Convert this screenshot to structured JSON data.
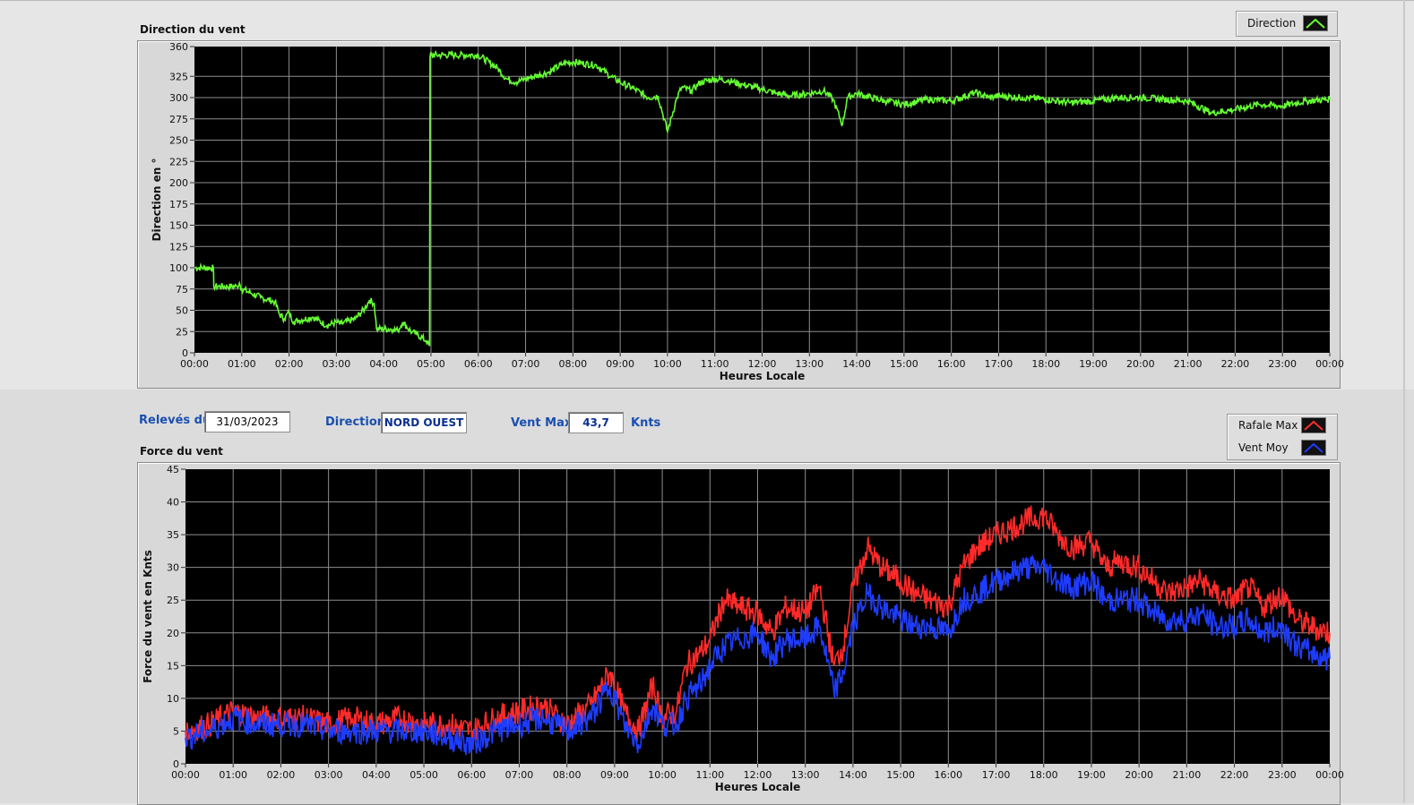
{
  "direction_panel": {
    "title": "Direction du vent",
    "legend": [
      {
        "label": "Direction",
        "color": "#66ff33"
      }
    ]
  },
  "info_bar": {
    "date_label": "Relevés du",
    "date_value": "31/03/2023",
    "direction_label": "Direction",
    "direction_value": "NORD OUEST",
    "ventmax_label": "Vent Max",
    "ventmax_value": "43,7",
    "ventmax_unit": "Knts"
  },
  "force_panel": {
    "title": "Force du vent",
    "legend": [
      {
        "label": "Rafale Max",
        "color": "#ff2a2a"
      },
      {
        "label": "Vent Moy",
        "color": "#1e3cff"
      }
    ]
  },
  "chart_data": [
    {
      "type": "line",
      "title": "Direction du vent",
      "xlabel": "Heures Locale",
      "ylabel": "Direction en °",
      "ylim": [
        0,
        360
      ],
      "xlim": [
        0,
        24
      ],
      "grid": true,
      "legend_position": "top-right",
      "x_ticks": [
        "00:00",
        "01:00",
        "02:00",
        "03:00",
        "04:00",
        "05:00",
        "06:00",
        "07:00",
        "08:00",
        "09:00",
        "10:00",
        "11:00",
        "12:00",
        "13:00",
        "14:00",
        "15:00",
        "16:00",
        "17:00",
        "18:00",
        "19:00",
        "20:00",
        "21:00",
        "22:00",
        "23:00",
        "00:00"
      ],
      "y_ticks": [
        "0",
        "25",
        "50",
        "75",
        "100",
        "125",
        "150",
        "175",
        "200",
        "225",
        "250",
        "275",
        "300",
        "325",
        "360"
      ],
      "series": [
        {
          "name": "Direction",
          "color": "#66ff33",
          "x": [
            0,
            0.4,
            0.41,
            0.9,
            0.95,
            1.0,
            1.2,
            1.4,
            1.7,
            1.8,
            1.9,
            2.0,
            2.1,
            2.2,
            2.5,
            2.8,
            3.0,
            3.1,
            3.4,
            3.6,
            3.7,
            3.8,
            3.85,
            4.2,
            4.3,
            4.4,
            4.6,
            4.7,
            4.9,
            4.97,
            4.98,
            5.0,
            5.5,
            6.0,
            6.4,
            6.6,
            6.8,
            7.0,
            7.5,
            7.8,
            8.0,
            8.5,
            8.8,
            9.0,
            9.3,
            9.6,
            9.8,
            10.0,
            10.2,
            10.3,
            10.5,
            10.7,
            11.0,
            11.3,
            11.6,
            12.0,
            12.3,
            12.6,
            13.0,
            13.3,
            13.5,
            13.7,
            13.8,
            14.0,
            14.3,
            14.6,
            15.0,
            15.5,
            16.0,
            16.5,
            16.8,
            17.0,
            17.5,
            18.0,
            18.5,
            19.0,
            19.5,
            20.0,
            20.5,
            21.0,
            21.5,
            22.0,
            22.5,
            23.0,
            23.5,
            24.0
          ],
          "y": [
            100,
            100,
            78,
            78,
            82,
            75,
            70,
            65,
            60,
            45,
            40,
            48,
            36,
            38,
            42,
            32,
            36,
            34,
            40,
            52,
            62,
            58,
            28,
            28,
            26,
            36,
            24,
            22,
            14,
            8,
            348,
            350,
            350,
            350,
            335,
            322,
            318,
            322,
            330,
            340,
            342,
            338,
            325,
            318,
            310,
            300,
            302,
            260,
            300,
            312,
            308,
            318,
            322,
            320,
            315,
            310,
            305,
            302,
            305,
            308,
            298,
            268,
            300,
            305,
            300,
            296,
            292,
            298,
            296,
            306,
            300,
            302,
            300,
            298,
            294,
            296,
            300,
            300,
            298,
            296,
            282,
            286,
            292,
            290,
            296,
            298
          ]
        }
      ]
    },
    {
      "type": "line",
      "title": "Force du vent",
      "xlabel": "Heures Locale",
      "ylabel": "Force du vent en Knts",
      "ylim": [
        0,
        45
      ],
      "xlim": [
        0,
        24
      ],
      "grid": true,
      "legend_position": "top-right",
      "x_ticks": [
        "00:00",
        "01:00",
        "02:00",
        "03:00",
        "04:00",
        "05:00",
        "06:00",
        "07:00",
        "08:00",
        "09:00",
        "10:00",
        "11:00",
        "12:00",
        "13:00",
        "14:00",
        "15:00",
        "16:00",
        "17:00",
        "18:00",
        "19:00",
        "20:00",
        "21:00",
        "22:00",
        "23:00",
        "00:00"
      ],
      "y_ticks": [
        "0",
        "5",
        "10",
        "15",
        "20",
        "25",
        "30",
        "35",
        "40",
        "45"
      ],
      "series": [
        {
          "name": "Rafale Max",
          "color": "#ff2a2a",
          "x": [
            0,
            0.5,
            1.0,
            1.5,
            2.0,
            2.5,
            3.0,
            3.5,
            4.0,
            4.5,
            5.0,
            5.5,
            6.0,
            6.5,
            7.0,
            7.5,
            8.0,
            8.5,
            8.9,
            9.2,
            9.5,
            9.8,
            10.0,
            10.3,
            10.5,
            10.8,
            11.0,
            11.3,
            11.6,
            12.0,
            12.3,
            12.6,
            13.0,
            13.3,
            13.6,
            13.8,
            14.0,
            14.3,
            14.6,
            15.0,
            15.3,
            15.6,
            16.0,
            16.3,
            16.6,
            17.0,
            17.3,
            17.6,
            18.0,
            18.3,
            18.6,
            19.0,
            19.3,
            19.6,
            20.0,
            20.3,
            20.6,
            21.0,
            21.3,
            21.6,
            22.0,
            22.3,
            22.6,
            23.0,
            23.3,
            23.6,
            24.0
          ],
          "y": [
            5,
            6,
            8,
            7,
            7,
            7,
            6,
            7,
            6,
            7,
            6,
            6,
            5,
            7,
            8,
            9,
            6,
            9,
            14,
            8,
            5,
            12,
            7,
            8,
            15,
            17,
            19,
            25,
            24,
            23,
            20,
            24,
            23,
            27,
            15,
            18,
            27,
            33,
            30,
            28,
            26,
            25,
            24,
            30,
            33,
            35,
            36,
            37,
            38,
            35,
            33,
            34,
            30,
            31,
            30,
            28,
            26,
            27,
            28,
            26,
            25,
            27,
            24,
            26,
            22,
            21,
            20
          ]
        },
        {
          "name": "Vent Moy",
          "color": "#1e3cff",
          "x": [
            0,
            0.5,
            1.0,
            1.5,
            2.0,
            2.5,
            3.0,
            3.5,
            4.0,
            4.5,
            5.0,
            5.5,
            6.0,
            6.5,
            7.0,
            7.5,
            8.0,
            8.5,
            8.9,
            9.2,
            9.5,
            9.8,
            10.0,
            10.3,
            10.5,
            10.8,
            11.0,
            11.3,
            11.6,
            12.0,
            12.3,
            12.6,
            13.0,
            13.3,
            13.6,
            13.8,
            14.0,
            14.3,
            14.6,
            15.0,
            15.3,
            15.6,
            16.0,
            16.3,
            16.6,
            17.0,
            17.3,
            17.6,
            18.0,
            18.3,
            18.6,
            19.0,
            19.3,
            19.6,
            20.0,
            20.3,
            20.6,
            21.0,
            21.3,
            21.6,
            22.0,
            22.3,
            22.6,
            23.0,
            23.3,
            23.6,
            24.0
          ],
          "y": [
            4,
            5,
            7,
            6,
            6,
            6,
            5,
            5,
            5,
            5,
            5,
            4,
            3,
            5,
            6,
            7,
            5,
            7,
            12,
            6,
            3,
            9,
            6,
            6,
            10,
            12,
            15,
            18,
            19,
            20,
            16,
            19,
            19,
            21,
            11,
            14,
            21,
            26,
            24,
            22,
            21,
            21,
            20,
            25,
            26,
            28,
            29,
            30,
            30,
            28,
            27,
            28,
            25,
            25,
            25,
            23,
            22,
            22,
            23,
            21,
            21,
            22,
            20,
            21,
            18,
            17,
            16
          ]
        }
      ]
    }
  ]
}
